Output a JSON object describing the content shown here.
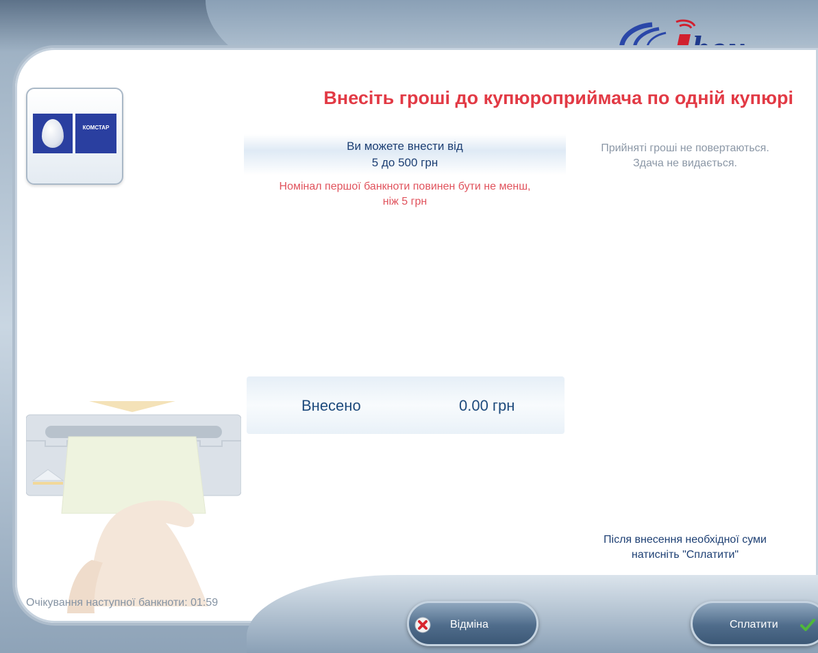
{
  "brand": {
    "logo_text": "ibox"
  },
  "provider": {
    "name": "КОМСТАР"
  },
  "title": "Внесіть гроші до купюроприймача по одній купюрі",
  "range": {
    "line1": "Ви можете внести від",
    "line2": "5 до 500 грн"
  },
  "min_note": {
    "line1": "Номінал першої банкноти повинен бути не менш,",
    "line2": "ніж 5 грн"
  },
  "side_note": {
    "line1": "Прийняті гроші не повертаються.",
    "line2": "Здача не видається."
  },
  "deposited": {
    "label": "Внесено",
    "amount": "0.00 грн"
  },
  "after_note": {
    "line1": "Після внесення необхідної суми",
    "line2": "натисніть \"Сплатити\""
  },
  "timer": {
    "text": "Очікування наступної банкноти: 01:59"
  },
  "buttons": {
    "cancel": "Відміна",
    "pay": "Сплатити"
  },
  "colors": {
    "title_red": "#e23a45",
    "text_navy": "#1d3f73",
    "muted_gray": "#8b97a6",
    "brand_blue": "#1f3a8c",
    "brand_red": "#d1202f"
  }
}
